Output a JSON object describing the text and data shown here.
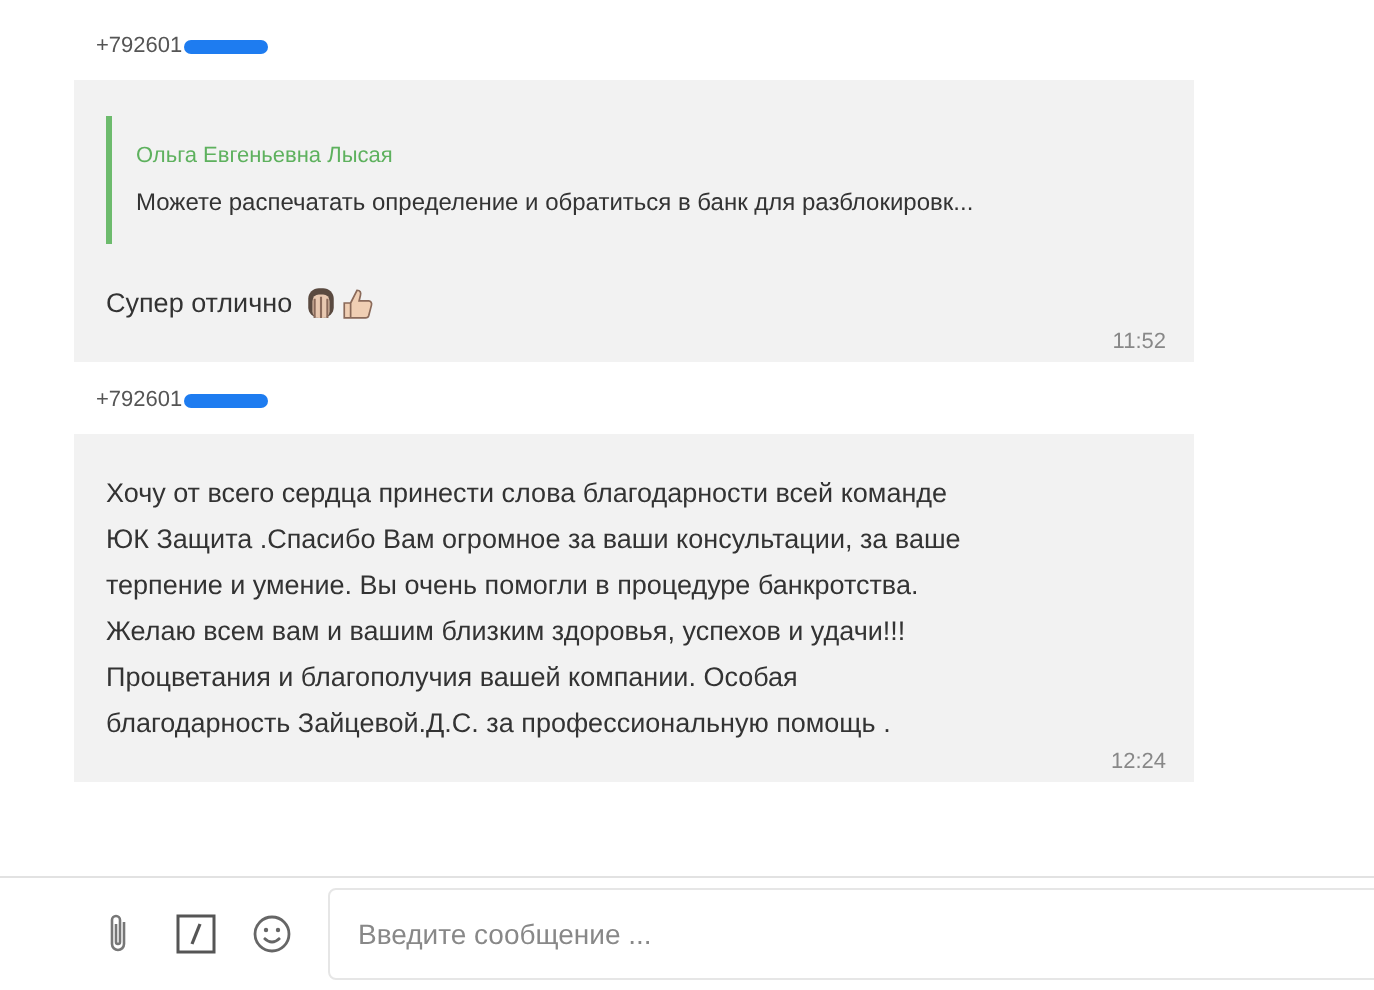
{
  "messages": [
    {
      "sender": "+792601",
      "quote": {
        "author": "Ольга Евгеньевна Лысая",
        "text": "Можете распечатать определение и обратиться в банк для разблокировк..."
      },
      "text": "Супер отлично",
      "emojis": [
        {
          "kind": "facepalm"
        },
        {
          "kind": "thumbs_up"
        }
      ],
      "time": "11:52"
    },
    {
      "sender": "+792601",
      "text": "Хочу от всего сердца принести слова благодарности всей команде\nЮК Защита .Спасибо Вам огромное за ваши консультации, за ваше\nтерпение и умение. Вы очень помогли в процедуре банкротства.\nЖелаю всем вам и вашим близким здоровья, успехов и удачи!!!\nПроцветания и благополучия вашей компании. Особая\nблагодарность Зайцевой.Д.С. за профессиональную помощь .",
      "time": "12:24"
    }
  ],
  "composer": {
    "placeholder": "Введите сообщение ..."
  }
}
